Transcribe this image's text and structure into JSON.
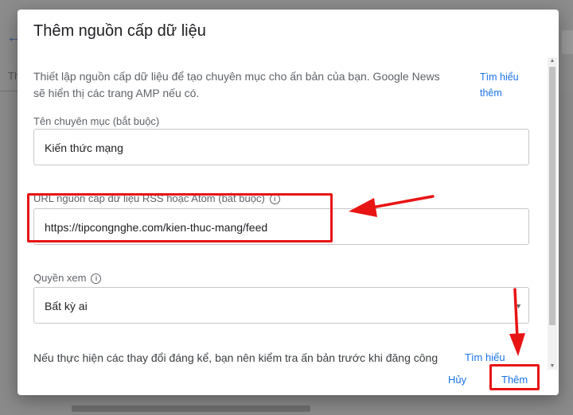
{
  "background": {
    "tab_fragment": "Th"
  },
  "dialog": {
    "title": "Thêm nguồn cấp dữ liệu",
    "intro": "Thiết lập nguồn cấp dữ liệu để tạo chuyên mục cho ấn bản của bạn. Google News sẽ hiển thị các trang AMP nếu có.",
    "learn_more": "Tìm hiểu thêm",
    "fields": {
      "section_name": {
        "label": "Tên chuyên mục (bắt buộc)",
        "value": "Kiến thức mạng"
      },
      "feed_url": {
        "label": "URL nguồn cấp dữ liệu RSS hoặc Atom (bắt buộc)",
        "value": "https://tipcongnghe.com/kien-thuc-mang/feed"
      },
      "view_permission": {
        "label": "Quyền xem",
        "value": "Bất kỳ ai"
      }
    },
    "bottom_note": "Nếu thực hiện các thay đổi đáng kể, bạn nên kiểm tra ấn bản trước khi đăng công",
    "bottom_learn_more": "Tìm hiểu",
    "actions": {
      "cancel": "Hủy",
      "add": "Thêm"
    }
  },
  "colors": {
    "accent": "#1a73e8",
    "annotation": "#e81414",
    "overlay": "#8a8a8a"
  },
  "icons": {
    "back": "arrow-left-icon",
    "info": "info-icon",
    "dropdown": "caret-down-icon"
  }
}
